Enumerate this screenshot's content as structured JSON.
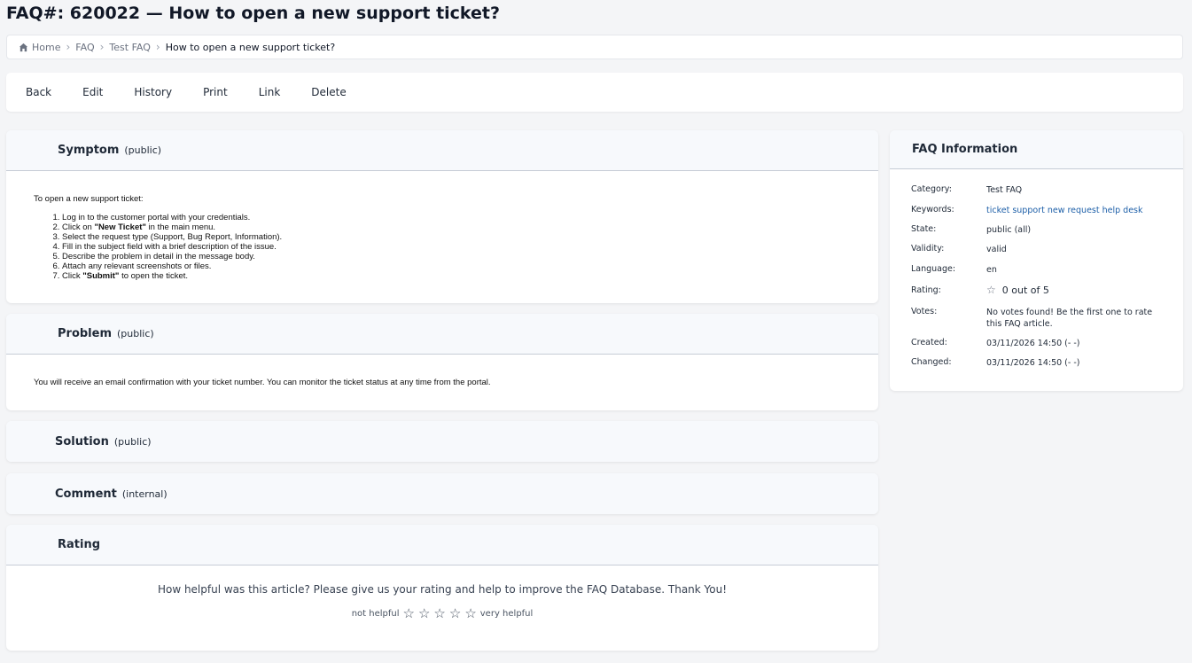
{
  "page": {
    "title": "FAQ#: 620022 — How to open a new support ticket?"
  },
  "breadcrumb": {
    "home": "Home",
    "items": [
      "FAQ",
      "Test FAQ"
    ],
    "current": "How to open a new support ticket?"
  },
  "toolbar": {
    "back": "Back",
    "edit": "Edit",
    "history": "History",
    "print": "Print",
    "link": "Link",
    "delete": "Delete"
  },
  "symptom": {
    "title": "Symptom",
    "tag": "(public)",
    "intro": "To open a new support ticket:",
    "steps": [
      {
        "pre": "Log in to the customer portal with your credentials.",
        "bold": "",
        "post": ""
      },
      {
        "pre": "Click on ",
        "bold": "\"New Ticket\"",
        "post": " in the main menu."
      },
      {
        "pre": "Select the request type (Support, Bug Report, Information).",
        "bold": "",
        "post": ""
      },
      {
        "pre": "Fill in the subject field with a brief description of the issue.",
        "bold": "",
        "post": ""
      },
      {
        "pre": "Describe the problem in detail in the message body.",
        "bold": "",
        "post": ""
      },
      {
        "pre": "Attach any relevant screenshots or files.",
        "bold": "",
        "post": ""
      },
      {
        "pre": "Click ",
        "bold": "\"Submit\"",
        "post": " to open the ticket."
      }
    ]
  },
  "problem": {
    "title": "Problem",
    "tag": "(public)",
    "text": "You will receive an email confirmation with your ticket number. You can monitor the ticket status at any time from the portal."
  },
  "solution": {
    "title": "Solution",
    "tag": "(public)"
  },
  "comment": {
    "title": "Comment",
    "tag": "(internal)"
  },
  "rating": {
    "title": "Rating",
    "question": "How helpful was this article? Please give us your rating and help to improve the FAQ Database. Thank You!",
    "low_label": "not helpful",
    "high_label": "very helpful",
    "star_count": 5
  },
  "info": {
    "title": "FAQ Information",
    "category_label": "Category:",
    "category": "Test FAQ",
    "keywords_label": "Keywords:",
    "keywords": "ticket support new request help desk",
    "state_label": "State:",
    "state": "public (all)",
    "validity_label": "Validity:",
    "validity": "valid",
    "language_label": "Language:",
    "language": "en",
    "rating_label": "Rating:",
    "rating_value": "0 out of 5",
    "votes_label": "Votes:",
    "votes": "No votes found! Be the first one to rate this FAQ article.",
    "created_label": "Created:",
    "created": "03/11/2026 14:50 (- -)",
    "changed_label": "Changed:",
    "changed": "03/11/2026 14:50 (- -)"
  },
  "colors": {
    "link": "#1d5fa8",
    "header_bg": "#f7f9fc",
    "page_bg": "#f4f5f7"
  }
}
